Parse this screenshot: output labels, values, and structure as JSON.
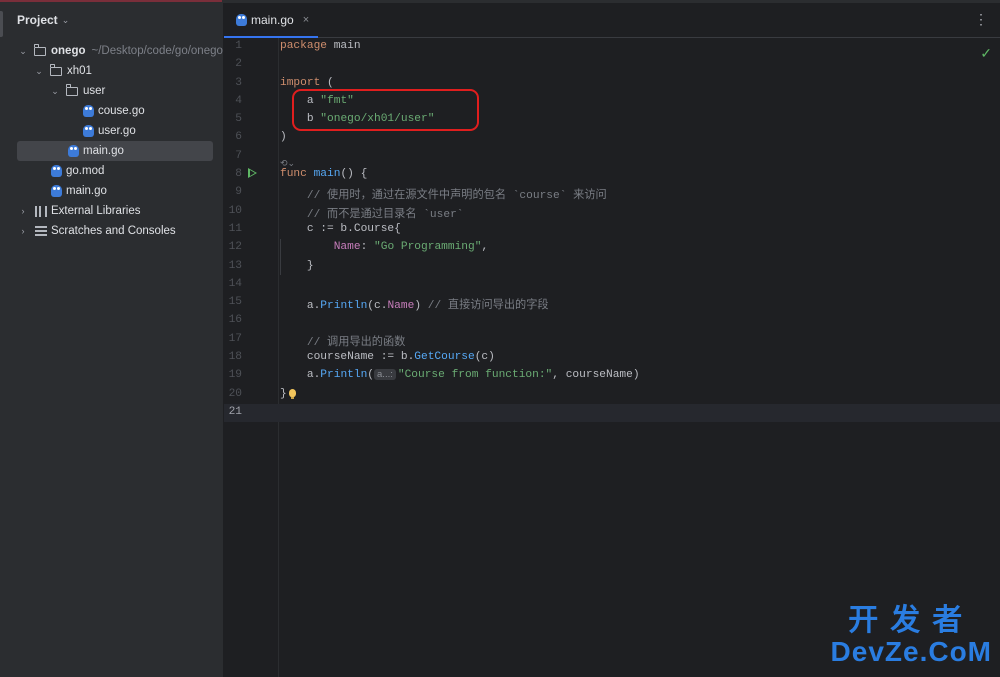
{
  "sidebar": {
    "title": "Project",
    "tree": [
      {
        "name": "onego",
        "path": "~/Desktop/code/go/onego"
      },
      {
        "name": "xh01"
      },
      {
        "name": "user"
      },
      {
        "name": "couse.go"
      },
      {
        "name": "user.go"
      },
      {
        "name": "main.go",
        "selected": true
      },
      {
        "name": "go.mod"
      },
      {
        "name": "main.go"
      },
      {
        "name": "External Libraries"
      },
      {
        "name": "Scratches and Consoles"
      }
    ]
  },
  "editor": {
    "tab": {
      "label": "main.go",
      "close": "×"
    },
    "code_lens": "⟲⌄",
    "inlay_hint": "a...:",
    "lines": [
      {
        "n": "1"
      },
      {
        "n": "2"
      },
      {
        "n": "3"
      },
      {
        "n": "4"
      },
      {
        "n": "5"
      },
      {
        "n": "6"
      },
      {
        "n": "7"
      },
      {
        "n": "8"
      },
      {
        "n": "9"
      },
      {
        "n": "10"
      },
      {
        "n": "11"
      },
      {
        "n": "12"
      },
      {
        "n": "13"
      },
      {
        "n": "14"
      },
      {
        "n": "15"
      },
      {
        "n": "16"
      },
      {
        "n": "17"
      },
      {
        "n": "18"
      },
      {
        "n": "19"
      },
      {
        "n": "20"
      },
      {
        "n": "21"
      }
    ],
    "code": {
      "l1_kw": "package",
      "l1_name": "main",
      "l3_kw": "import",
      "l3_paren": "(",
      "l4_alias": "a",
      "l4_path": "\"fmt\"",
      "l5_alias": "b",
      "l5_path": "\"onego/xh01/user\"",
      "l6": ")",
      "l8_kw": "func",
      "l8_fn": "main",
      "l8_rest": "() {",
      "l9": "// 使用时，通过在源文件中声明的包名 `course` 来访问",
      "l10": "// 而不是通过目录名 `user`",
      "l11_a": "c := b.",
      "l11_b": "Course",
      "l11_c": "{",
      "l12_field": "Name",
      "l12_colon": ": ",
      "l12_str": "\"Go Programming\"",
      "l12_end": ",",
      "l13": "}",
      "l15_a": "a.",
      "l15_fn": "Println",
      "l15_b": "(c.",
      "l15_field": "Name",
      "l15_c": ") ",
      "l15_cm": "// 直接访问导出的字段",
      "l17": "// 调用导出的函数",
      "l18_a": "courseName := b.",
      "l18_fn": "GetCourse",
      "l18_b": "(c)",
      "l19_a": "a.",
      "l19_fn": "Println",
      "l19_b": "(",
      "l19_str": "\"Course from function:\"",
      "l19_c": ", courseName)",
      "l20": "}"
    },
    "status_check": "✓",
    "menu_icon": "⋮"
  },
  "watermark": {
    "line1": "开发者",
    "line2": "DevZe.CoM"
  },
  "colors": {
    "accent": "#3574f0",
    "highlight_box": "#e01e1e",
    "watermark": "#2a7de1"
  }
}
